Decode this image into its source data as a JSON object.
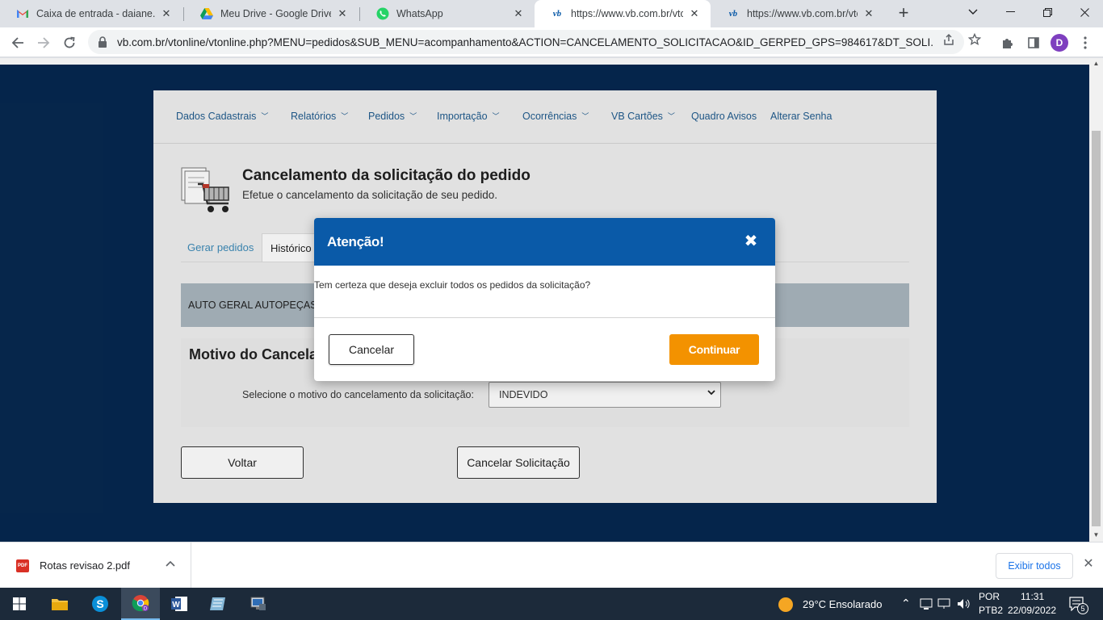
{
  "browser": {
    "tabs": [
      {
        "title": "Caixa de entrada - daiane.rodrigues",
        "icon": "gmail-icon"
      },
      {
        "title": "Meu Drive - Google Drive",
        "icon": "google-drive-icon"
      },
      {
        "title": "WhatsApp",
        "icon": "whatsapp-icon"
      },
      {
        "title": "https://www.vb.com.br/vtonline",
        "icon": "vb-icon"
      },
      {
        "title": "https://www.vb.com.br/vtonline",
        "icon": "vb-icon"
      }
    ],
    "active_tab_index": 3,
    "url": "vb.com.br/vtonline/vtonline.php?MENU=pedidos&SUB_MENU=acompanhamento&ACTION=CANCELAMENTO_SOLICITACAO&ID_GERPED_GPS=984617&DT_SOLI...",
    "profile_initial": "D"
  },
  "site": {
    "nav": [
      {
        "label": "Dados Cadastrais",
        "dropdown": true
      },
      {
        "label": "Relatórios",
        "dropdown": true
      },
      {
        "label": "Pedidos",
        "dropdown": true
      },
      {
        "label": "Importação",
        "dropdown": true
      },
      {
        "label": "Ocorrências",
        "dropdown": true
      },
      {
        "label": "VB Cartões",
        "dropdown": true
      },
      {
        "label": "Quadro Avisos",
        "dropdown": false
      },
      {
        "label": "Alterar Senha",
        "dropdown": false
      }
    ],
    "page_title": "Cancelamento da solicitação do pedido",
    "page_subtitle": "Efetue o cancelamento da solicitação de seu pedido.",
    "subtabs": {
      "gerar": "Gerar pedidos",
      "historico": "Histórico"
    },
    "company": "AUTO GERAL AUTOPEÇAS",
    "motivo_title": "Motivo do Cancela",
    "motivo_label": "Selecione o motivo do cancelamento da solicitação:",
    "motivo_selected": "INDEVIDO",
    "back_button": "Voltar",
    "cancel_request_button": "Cancelar Solicitação"
  },
  "modal": {
    "title": "Atenção!",
    "message": "Tem certeza que deseja excluir todos os pedidos da solicitação?",
    "cancel": "Cancelar",
    "continue": "Continuar"
  },
  "downloads": {
    "file": "Rotas revisao 2.pdf",
    "file_badge": "PDF",
    "show_all": "Exibir todos"
  },
  "taskbar": {
    "weather": "29°C  Ensolarado",
    "lang_top": "POR",
    "lang_bottom": "PTB2",
    "time": "11:31",
    "date": "22/09/2022",
    "notifications": "5"
  },
  "colors": {
    "page_bg": "#062850",
    "modal_header": "#0a5aa8",
    "continue_button": "#f39200",
    "nav_link": "#1f5b8e"
  }
}
